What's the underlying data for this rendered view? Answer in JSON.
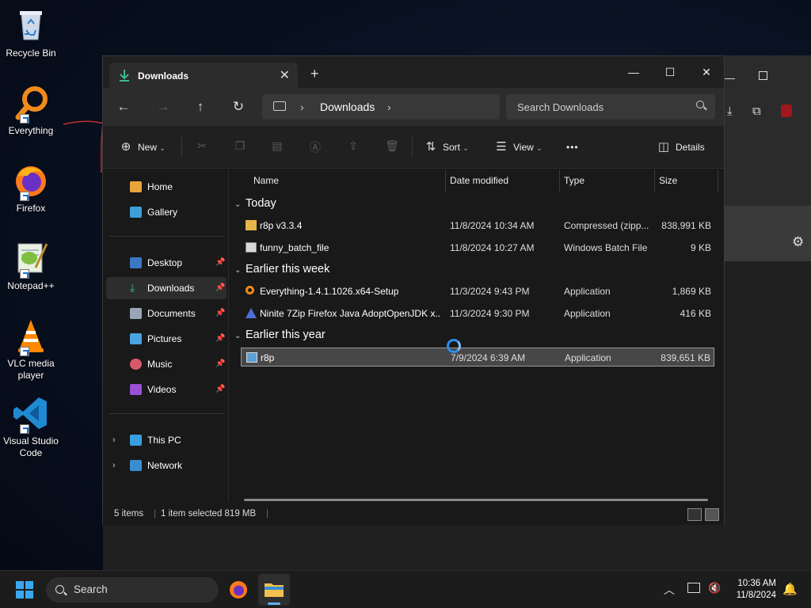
{
  "desktop": {
    "icons": [
      {
        "label": "Recycle Bin"
      },
      {
        "label": "Everything"
      },
      {
        "label": "Firefox"
      },
      {
        "label": "Notepad++"
      },
      {
        "label": "VLC media player"
      },
      {
        "label": "Visual Studio Code"
      }
    ]
  },
  "explorer": {
    "tab": {
      "title": "Downloads"
    },
    "window_controls": {
      "minimize": "—",
      "maximize": "☐",
      "close": "✕"
    },
    "address": {
      "crumb": "Downloads"
    },
    "search": {
      "placeholder": "Search Downloads"
    },
    "commands": {
      "new": "New",
      "sort": "Sort",
      "view": "View",
      "more": "•••",
      "details": "Details"
    },
    "sidebar": {
      "home": "Home",
      "gallery": "Gallery",
      "desktop": "Desktop",
      "downloads": "Downloads",
      "documents": "Documents",
      "pictures": "Pictures",
      "music": "Music",
      "videos": "Videos",
      "this_pc": "This PC",
      "network": "Network"
    },
    "columns": {
      "name": "Name",
      "date": "Date modified",
      "type": "Type",
      "size": "Size"
    },
    "groups": [
      {
        "label": "Today"
      },
      {
        "label": "Earlier this week"
      },
      {
        "label": "Earlier this year"
      }
    ],
    "files": [
      {
        "name": "r8p v3.3.4",
        "date": "11/8/2024 10:34 AM",
        "type": "Compressed (zipp...",
        "size": "838,991 KB",
        "icon": "zip-folder-icon"
      },
      {
        "name": "funny_batch_file",
        "date": "11/8/2024 10:27 AM",
        "type": "Windows Batch File",
        "size": "9 KB",
        "icon": "batch-file-icon"
      },
      {
        "name": "Everything-1.4.1.1026.x64-Setup",
        "date": "11/3/2024 9:43 PM",
        "type": "Application",
        "size": "1,869 KB",
        "icon": "everything-icon"
      },
      {
        "name": "Ninite 7Zip Firefox Java AdoptOpenJDK x...",
        "date": "11/3/2024 9:30 PM",
        "type": "Application",
        "size": "416 KB",
        "icon": "ninite-icon"
      },
      {
        "name": "r8p",
        "date": "7/9/2024 6:39 AM",
        "type": "Application",
        "size": "839,651 KB",
        "icon": "application-icon",
        "selected": true
      }
    ],
    "status": {
      "items": "5 items",
      "selected": "1 item selected  819 MB"
    }
  },
  "taskbar": {
    "search_placeholder": "Search",
    "time": "10:36 AM",
    "date": "11/8/2024"
  },
  "colors": {
    "accent": "#2b8fe8",
    "selection": "#474747",
    "window_bg": "#191919"
  }
}
